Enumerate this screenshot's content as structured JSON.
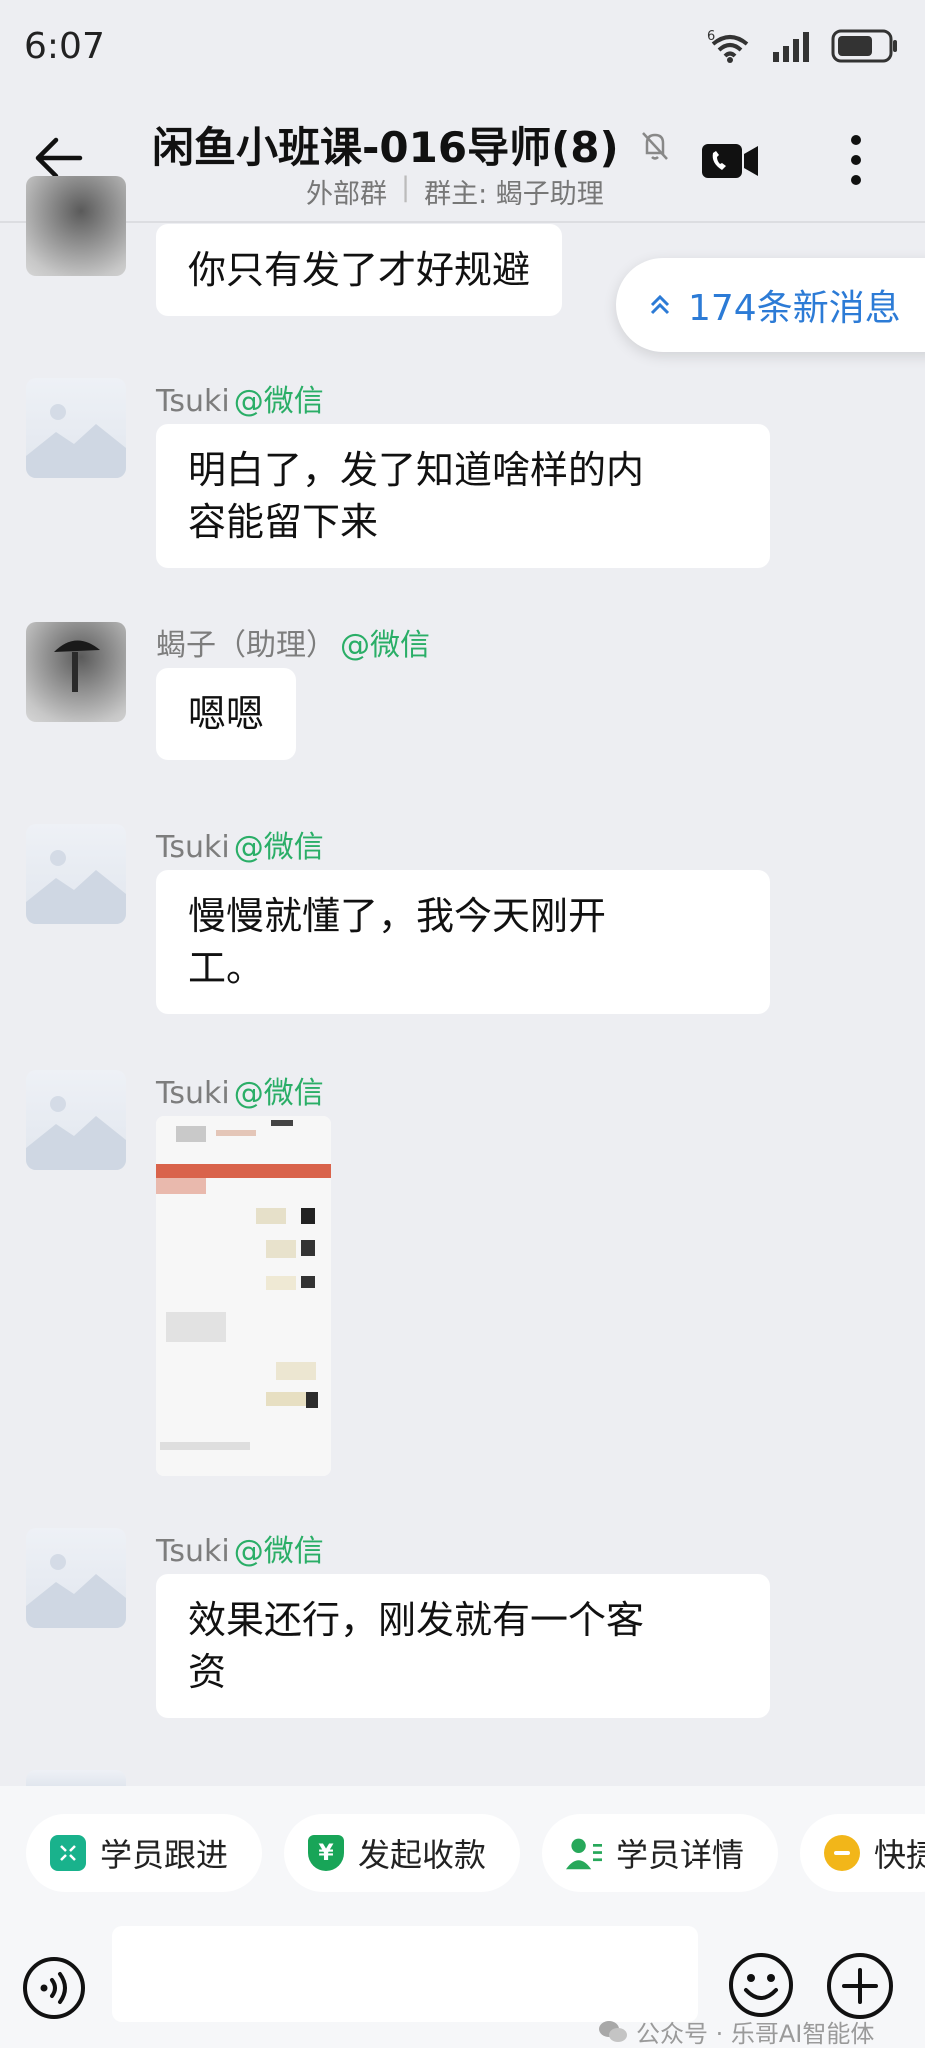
{
  "status_bar": {
    "time": "6:07",
    "network_badge": "6"
  },
  "header": {
    "title": "闲鱼小班课-016导师",
    "count": "(8)",
    "group_type": "外部群",
    "divider": "|",
    "owner": "群主: 蝎子助理"
  },
  "new_messages": {
    "label": "174条新消息"
  },
  "messages": [
    {
      "text": "你只有发了才好规避"
    },
    {
      "sender": "Tsuki",
      "org": "@微信",
      "lines": [
        "明白了，发了知道啥样的内",
        "容能留下来"
      ]
    },
    {
      "sender": "蝎子（助理）",
      "org": "@微信",
      "lines": [
        "嗯嗯"
      ]
    },
    {
      "sender": "Tsuki",
      "org": "@微信",
      "lines": [
        "慢慢就懂了，我今天刚开",
        "工。"
      ]
    },
    {
      "sender": "Tsuki",
      "org": "@微信",
      "image": true
    },
    {
      "sender": "Tsuki",
      "org": "@微信",
      "lines": [
        "效果还行，刚发就有一个客",
        "资"
      ]
    }
  ],
  "quick_actions": [
    {
      "label": "学员跟进",
      "color": "#19b28c"
    },
    {
      "label": "发起收款",
      "color": "#18a558"
    },
    {
      "label": "学员详情",
      "color": "#27a85a"
    },
    {
      "label": "快捷",
      "color": "#f2b619"
    }
  ],
  "input": {
    "placeholder": ""
  },
  "watermark": "公众号 · 乐哥AI智能体",
  "colors": {
    "accent_green": "#2aae67",
    "link_blue": "#2c7bd6",
    "background": "#edeef2"
  }
}
